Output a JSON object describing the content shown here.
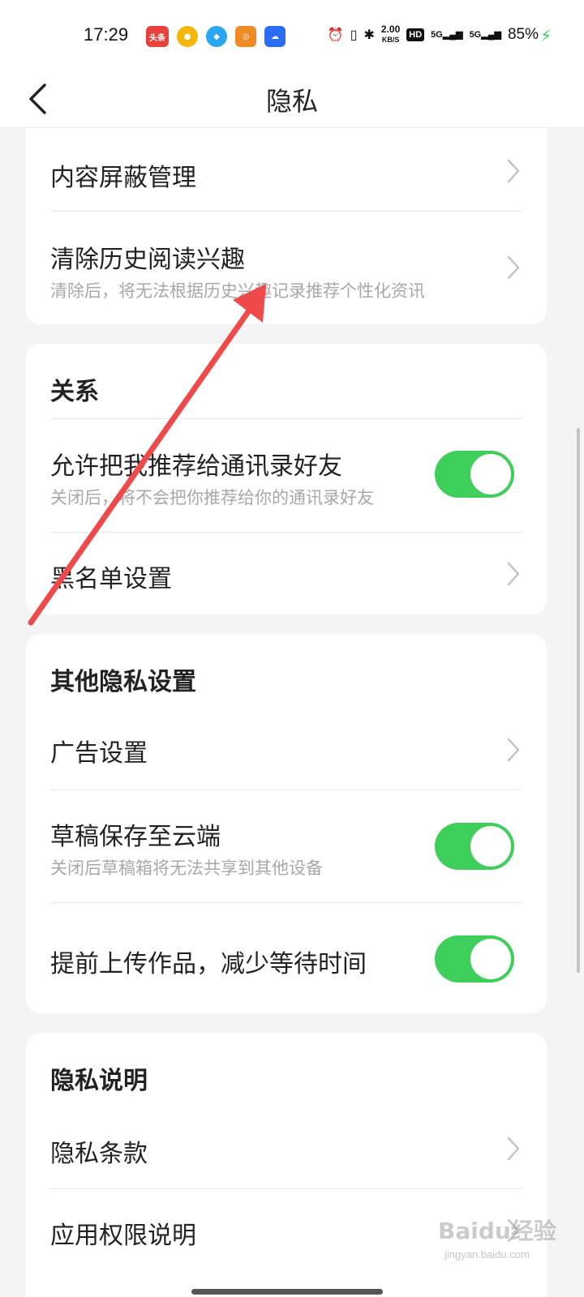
{
  "status_bar": {
    "time": "17:29",
    "notifications": [
      {
        "icon": "toutiao-icon",
        "label": "头条"
      },
      {
        "icon": "weibo-icon",
        "label": ""
      },
      {
        "icon": "qq-icon",
        "label": ""
      },
      {
        "icon": "app-icon",
        "label": ""
      },
      {
        "icon": "cloud-app-icon",
        "label": ""
      }
    ],
    "net_speed_value": "2.00",
    "net_speed_unit": "KB/S",
    "hd_label": "HD",
    "signal1": "5G",
    "signal2": "5G",
    "battery": "85%"
  },
  "header": {
    "title": "隐私"
  },
  "sections": {
    "content": {
      "rows": [
        {
          "title": "内容屏蔽管理"
        },
        {
          "title": "清除历史阅读兴趣",
          "subtitle": "清除后，将无法根据历史兴趣记录推荐个性化资讯"
        }
      ]
    },
    "relations": {
      "title": "关系",
      "rows": [
        {
          "title": "允许把我推荐给通讯录好友",
          "subtitle": "关闭后，将不会把你推荐给你的通讯录好友",
          "toggle_on": true
        },
        {
          "title": "黑名单设置"
        }
      ]
    },
    "other": {
      "title": "其他隐私设置",
      "rows": [
        {
          "title": "广告设置"
        },
        {
          "title": "草稿保存至云端",
          "subtitle": "关闭后草稿箱将无法共享到其他设备",
          "toggle_on": true
        },
        {
          "title": "提前上传作品，减少等待时间",
          "toggle_on": true
        }
      ]
    },
    "privacy_info": {
      "title": "隐私说明",
      "rows": [
        {
          "title": "隐私条款"
        },
        {
          "title": "应用权限说明"
        }
      ]
    }
  },
  "colors": {
    "toggle_on": "#3ecf5b",
    "annotation_arrow": "#ef4a4a",
    "background": "#f4f4f4"
  },
  "watermark": {
    "brand": "Baidu经验",
    "url": "jingyan.baidu.com"
  }
}
